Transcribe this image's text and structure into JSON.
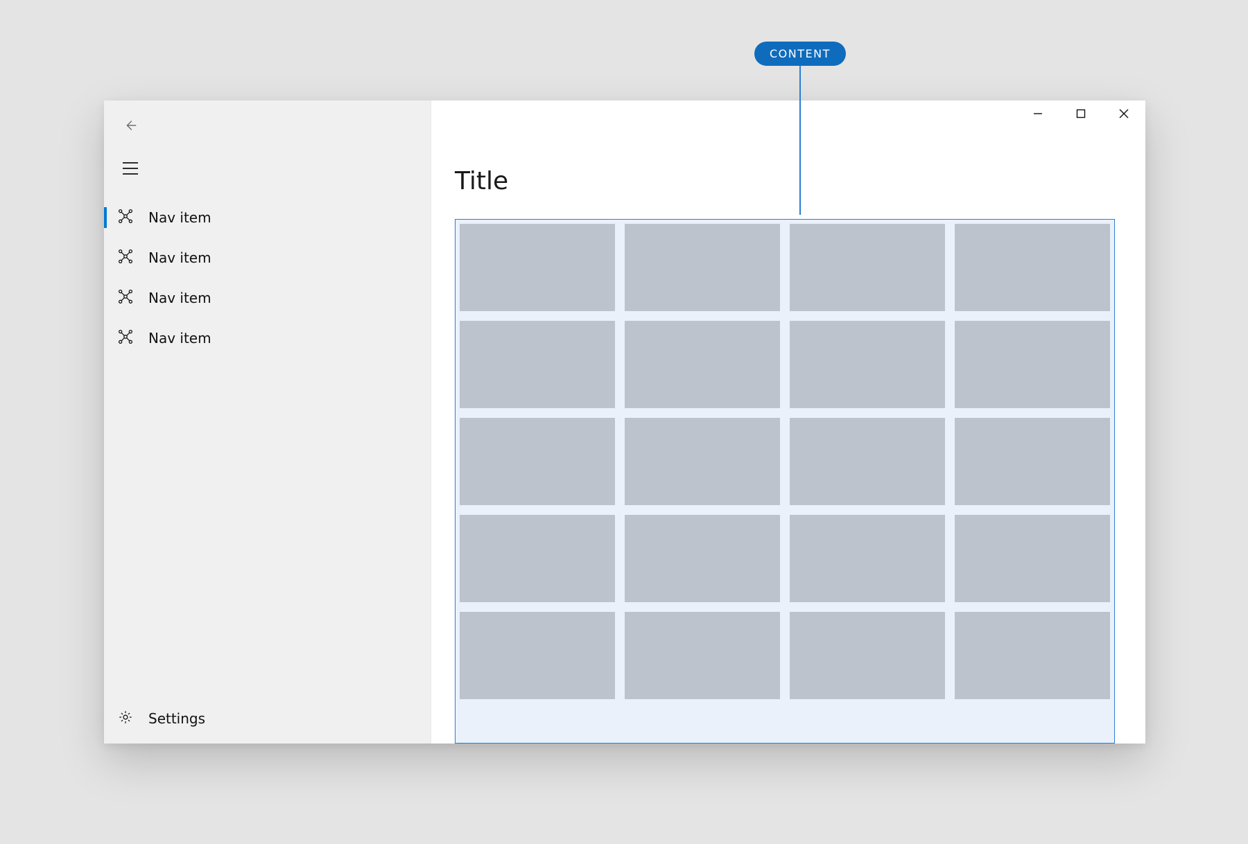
{
  "annotation": {
    "label": "CONTENT"
  },
  "sidebar": {
    "items": [
      {
        "label": "Nav item",
        "selected": true
      },
      {
        "label": "Nav item",
        "selected": false
      },
      {
        "label": "Nav item",
        "selected": false
      },
      {
        "label": "Nav item",
        "selected": false
      }
    ],
    "settings_label": "Settings"
  },
  "content": {
    "title": "Title",
    "grid": {
      "columns": 4,
      "rows": 5
    }
  },
  "colors": {
    "accent": "#0078d4",
    "annotation_bg": "#0f6cbd",
    "grid_outline": "#2b7cd3",
    "grid_bg": "#eaf1fa",
    "tile": "#bcc3cc",
    "sidebar_bg": "#f0f0f0"
  }
}
